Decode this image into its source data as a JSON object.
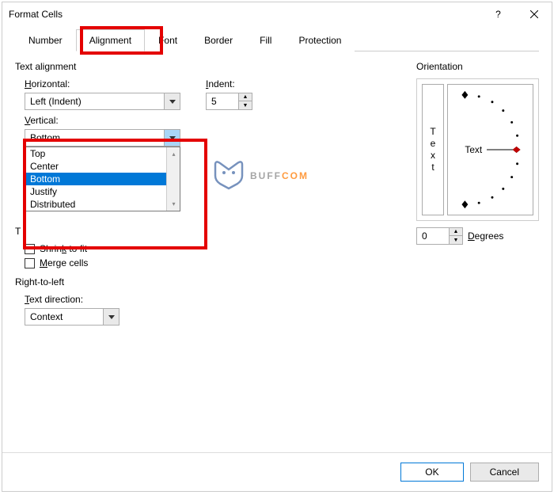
{
  "window": {
    "title": "Format Cells"
  },
  "tabs": [
    "Number",
    "Alignment",
    "Font",
    "Border",
    "Fill",
    "Protection"
  ],
  "activeTab": 1,
  "alignment": {
    "section_label": "Text alignment",
    "horizontal_label": "Horizontal:",
    "horizontal_value": "Left (Indent)",
    "indent_label": "Indent:",
    "indent_value": "5",
    "vertical_label": "Vertical:",
    "vertical_value": "Bottom",
    "vertical_options": [
      "Top",
      "Center",
      "Bottom",
      "Justify",
      "Distributed"
    ],
    "vertical_selected_index": 2
  },
  "textControl": {
    "section_label": "Text control",
    "shrink_label": "Shrink to fit",
    "merge_label": "Merge cells"
  },
  "rtl": {
    "section_label": "Right-to-left",
    "direction_label": "Text direction:",
    "direction_value": "Context"
  },
  "orientation": {
    "section_label": "Orientation",
    "text_label": "Text",
    "vertical_text": [
      "T",
      "e",
      "x",
      "t"
    ],
    "degrees_value": "0",
    "degrees_label": "Degrees"
  },
  "buttons": {
    "ok": "OK",
    "cancel": "Cancel"
  },
  "watermark": {
    "part1": "BUFF",
    "part2": "COM"
  }
}
